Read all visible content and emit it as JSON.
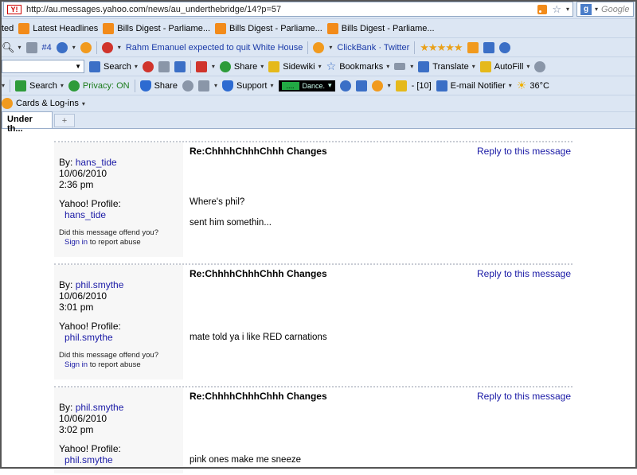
{
  "browser": {
    "url": "http://au.messages.yahoo.com/news/au_underthebridge/14?p=57",
    "search_placeholder": "Google",
    "bookmarks_bar": [
      "ted",
      "Latest Headlines",
      "Bills Digest - Parliame...",
      "Bills Digest - Parliame...",
      "Bills Digest - Parliame..."
    ],
    "toolbar2": {
      "number_badge": "#4",
      "headline": "Rahm Emanuel expected to quit White House",
      "clickbank": "ClickBank · Twitter"
    },
    "toolbar3": {
      "search": "Search",
      "share": "Share",
      "sidewiki": "Sidewiki",
      "bookmarks": "Bookmarks",
      "translate": "Translate",
      "autofill": "AutoFill"
    },
    "toolbar4": {
      "search": "Search",
      "privacy": "Privacy: ON",
      "share": "Share",
      "support": "Support",
      "dance": "Dance.",
      "count": "- [10]",
      "email": "E-mail Notifier",
      "temp": "36°C"
    },
    "toolbar5": {
      "cards": "Cards & Log-ins"
    },
    "tab": {
      "title": "Under th...",
      "new_tab": "+"
    }
  },
  "posts": [
    {
      "by_label": "By:",
      "author": "hans_tide",
      "date": "10/06/2010",
      "time": "2:36 pm",
      "profile_label": "Yahoo! Profile:",
      "profile_name": "hans_tide",
      "offend": "Did this message offend you?",
      "sign_in": "Sign in",
      "report": "to report abuse",
      "subject": "Re:ChhhhChhhChhh Changes",
      "reply": "Reply to this message",
      "body": [
        "Where's phil?",
        "sent him somethin..."
      ]
    },
    {
      "by_label": "By:",
      "author": "phil.smythe",
      "date": "10/06/2010",
      "time": "3:01 pm",
      "profile_label": "Yahoo! Profile:",
      "profile_name": "phil.smythe",
      "offend": "Did this message offend you?",
      "sign_in": "Sign in",
      "report": "to report abuse",
      "subject": "Re:ChhhhChhhChhh Changes",
      "reply": "Reply to this message",
      "body": [
        "mate told ya i like RED carnations"
      ]
    },
    {
      "by_label": "By:",
      "author": "phil.smythe",
      "date": "10/06/2010",
      "time": "3:02 pm",
      "profile_label": "Yahoo! Profile:",
      "profile_name": "phil.smythe",
      "subject": "Re:ChhhhChhhChhh Changes",
      "reply": "Reply to this message",
      "body": [
        "pink ones make me sneeze"
      ]
    }
  ]
}
